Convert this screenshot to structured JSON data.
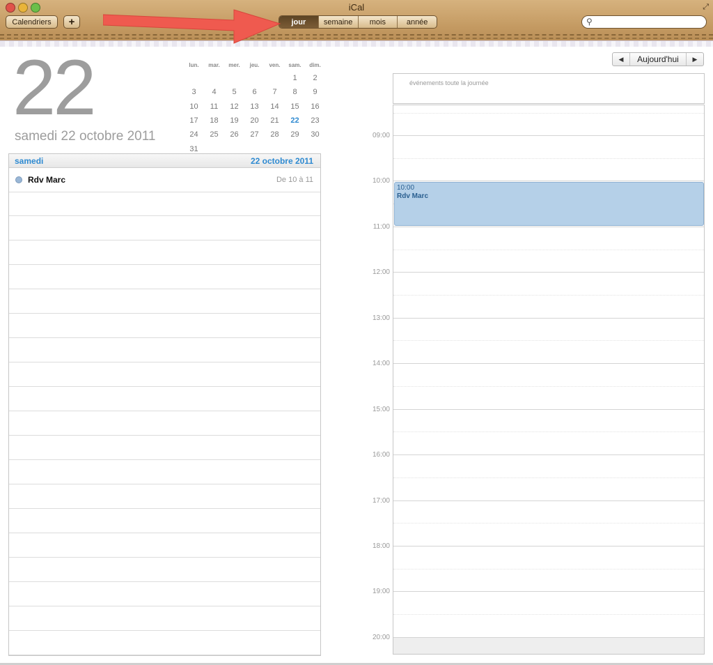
{
  "window": {
    "title": "iCal"
  },
  "toolbar": {
    "calendars_label": "Calendriers",
    "add_label": "+",
    "views": [
      "jour",
      "semaine",
      "mois",
      "année"
    ],
    "active_view": "jour",
    "search": {
      "value": "",
      "placeholder": ""
    }
  },
  "date_header": {
    "day_number": "22",
    "long_date": "samedi 22 octobre 2011"
  },
  "mini_calendar": {
    "weekdays": [
      "lun.",
      "mar.",
      "mer.",
      "jeu.",
      "ven.",
      "sam.",
      "dim."
    ],
    "weeks": [
      [
        "",
        "",
        "",
        "",
        "",
        "1",
        "2"
      ],
      [
        "3",
        "4",
        "5",
        "6",
        "7",
        "8",
        "9"
      ],
      [
        "10",
        "11",
        "12",
        "13",
        "14",
        "15",
        "16"
      ],
      [
        "17",
        "18",
        "19",
        "20",
        "21",
        "22",
        "23"
      ],
      [
        "24",
        "25",
        "26",
        "27",
        "28",
        "29",
        "30"
      ],
      [
        "31",
        "",
        "",
        "",
        "",
        "",
        ""
      ]
    ],
    "selected_day": "22"
  },
  "event_list": {
    "day_label": "samedi",
    "date_label": "22 octobre 2011",
    "events": [
      {
        "title": "Rdv Marc",
        "time": "De 10 à 11"
      }
    ]
  },
  "navigation": {
    "prev": "◀",
    "today_label": "Aujourd'hui",
    "next": "▶"
  },
  "day_view": {
    "all_day_label": "événements toute la journée",
    "hours": [
      "09:00",
      "10:00",
      "11:00",
      "12:00",
      "13:00",
      "14:00",
      "15:00",
      "16:00",
      "17:00",
      "18:00",
      "19:00",
      "20:00"
    ],
    "event": {
      "time": "10:00",
      "title": "Rdv Marc"
    }
  },
  "colors": {
    "accent_blue": "#2e8ad1",
    "event_fill": "#b5d0e8",
    "toolbar_leather": "#c49a62",
    "annotation_arrow": "#ef5a4f"
  }
}
